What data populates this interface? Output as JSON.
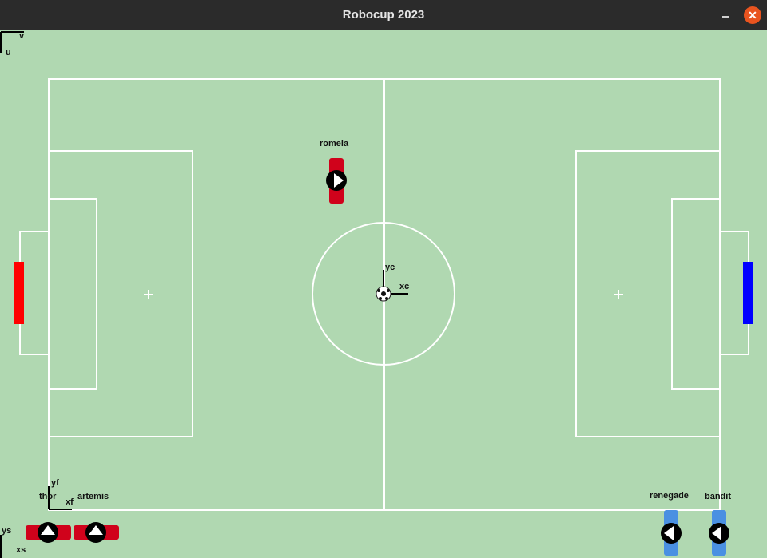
{
  "window": {
    "title": "Robocup 2023",
    "close_glyph": "✕"
  },
  "colors": {
    "field": "#b0d8b1",
    "lines": "#ffffff",
    "red_team": "#d0021b",
    "blue_team": "#4a90e2",
    "red_goal": "#ff0000",
    "blue_goal": "#0000ff"
  },
  "frames": {
    "image": {
      "x": "v",
      "y": "u"
    },
    "center": {
      "x": "xc",
      "y": "yc"
    },
    "field": {
      "x": "xf",
      "y": "yf"
    },
    "screen": {
      "x": "xs",
      "y": "ys"
    }
  },
  "robots": [
    {
      "name": "romela",
      "team": "red",
      "icon": "play-arrow-icon",
      "heading": "right"
    },
    {
      "name": "thor",
      "team": "red",
      "icon": "up-arrow-icon",
      "heading": "up"
    },
    {
      "name": "artemis",
      "team": "red",
      "icon": "up-arrow-icon",
      "heading": "up"
    },
    {
      "name": "renegade",
      "team": "blue",
      "icon": "left-arrow-icon",
      "heading": "left"
    },
    {
      "name": "bandit",
      "team": "blue",
      "icon": "left-arrow-icon",
      "heading": "left"
    }
  ],
  "ball": {
    "icon": "soccer-ball-icon"
  }
}
